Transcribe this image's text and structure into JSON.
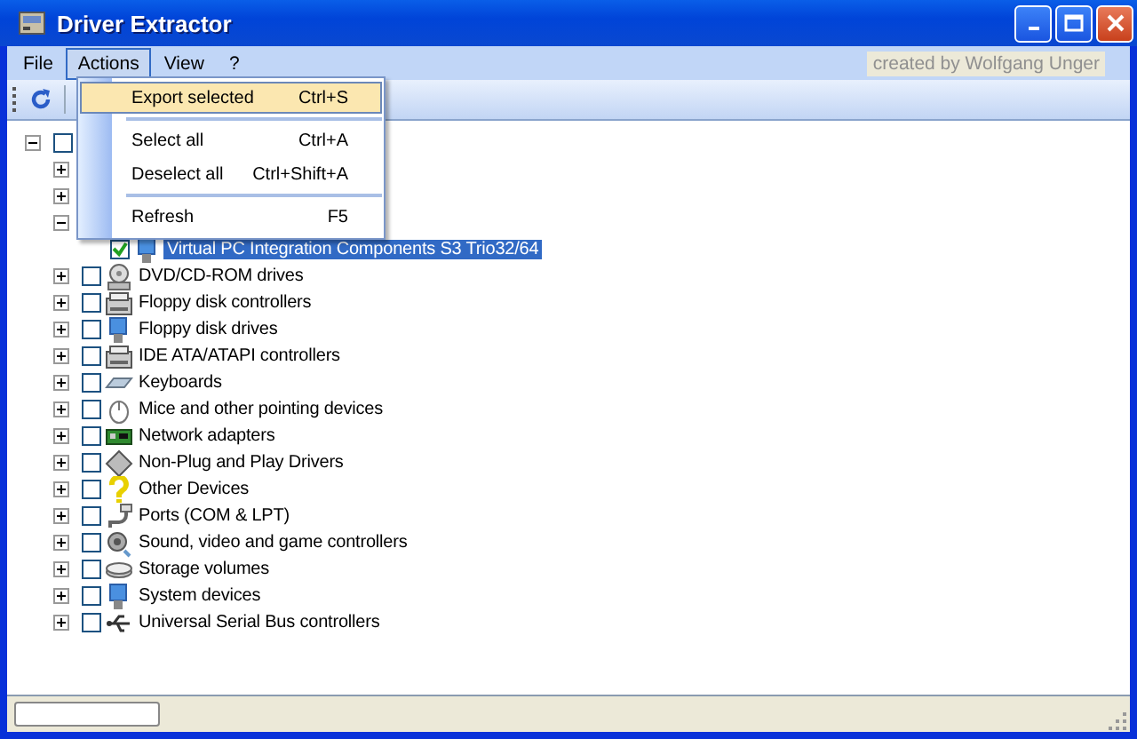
{
  "window": {
    "title": "Driver Extractor"
  },
  "menu_bar": [
    {
      "label": "File",
      "selected": false
    },
    {
      "label": "Actions",
      "selected": true
    },
    {
      "label": "View",
      "selected": false
    },
    {
      "label": "?",
      "selected": false
    }
  ],
  "credit": "created by Wolfgang Unger",
  "open_menu": {
    "items": [
      {
        "kind": "item",
        "label": "Export selected",
        "shortcut": "Ctrl+S",
        "selected": true
      },
      {
        "kind": "separator"
      },
      {
        "kind": "item",
        "label": "Select all",
        "shortcut": "Ctrl+A",
        "selected": false
      },
      {
        "kind": "item",
        "label": "Deselect all",
        "shortcut": "Ctrl+Shift+A",
        "selected": false
      },
      {
        "kind": "separator"
      },
      {
        "kind": "item",
        "label": "Refresh",
        "shortcut": "F5",
        "selected": false
      }
    ]
  },
  "tree": [
    {
      "expanded": true,
      "checked": false,
      "children": [
        {
          "expanded": false
        },
        {
          "expanded": false
        },
        {
          "expanded": true,
          "children": [
            {
              "label": "Virtual PC Integration Components S3 Trio32/64",
              "checked": true,
              "selected": true
            }
          ]
        },
        {
          "label": "DVD/CD-ROM drives",
          "expanded": false,
          "checked": false,
          "selected": false
        },
        {
          "label": "Floppy disk controllers",
          "expanded": false,
          "checked": false,
          "selected": false
        },
        {
          "label": "Floppy disk drives",
          "expanded": false,
          "checked": false,
          "selected": false
        },
        {
          "label": "IDE ATA/ATAPI controllers",
          "expanded": false,
          "checked": false,
          "selected": false
        },
        {
          "label": "Keyboards",
          "expanded": false,
          "checked": false,
          "selected": false
        },
        {
          "label": "Mice and other pointing devices",
          "expanded": false,
          "checked": false,
          "selected": false
        },
        {
          "label": "Network adapters",
          "expanded": false,
          "checked": false,
          "selected": false
        },
        {
          "label": "Non-Plug and Play Drivers",
          "expanded": false,
          "checked": false,
          "selected": false
        },
        {
          "label": "Other Devices",
          "expanded": false,
          "checked": false,
          "selected": false
        },
        {
          "label": "Ports (COM & LPT)",
          "expanded": false,
          "checked": false,
          "selected": false
        },
        {
          "label": "Sound, video and game controllers",
          "expanded": false,
          "checked": false,
          "selected": false
        },
        {
          "label": "Storage volumes",
          "expanded": false,
          "checked": false,
          "selected": false
        },
        {
          "label": "System devices",
          "expanded": false,
          "checked": false,
          "selected": false
        },
        {
          "label": "Universal Serial Bus controllers",
          "expanded": false,
          "checked": false,
          "selected": false
        }
      ]
    }
  ]
}
